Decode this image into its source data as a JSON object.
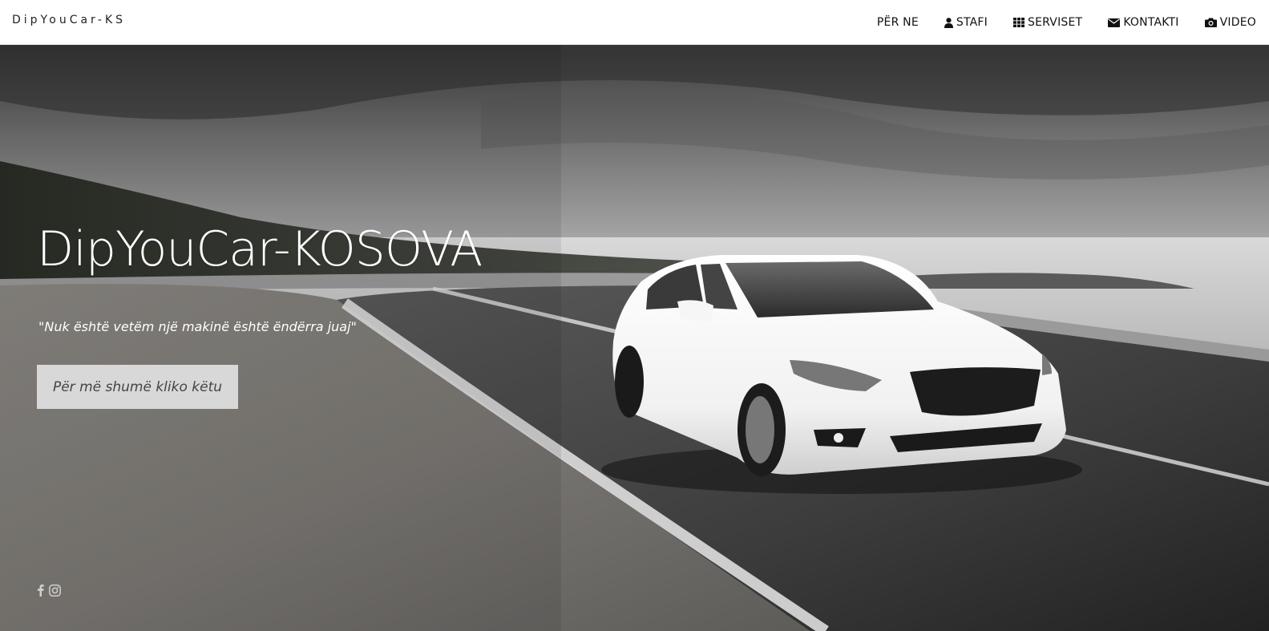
{
  "navbar": {
    "brand": "DipYouCar-KS",
    "items": [
      {
        "label": "PËR NE",
        "icon": ""
      },
      {
        "label": "STAFI",
        "icon": "user-icon"
      },
      {
        "label": "SERVISET",
        "icon": "grid-icon"
      },
      {
        "label": "KONTAKTI",
        "icon": "envelope-icon"
      },
      {
        "label": "VIDEO",
        "icon": "camera-icon"
      }
    ]
  },
  "hero": {
    "title": "DipYouCar-KOSOVA",
    "tagline": "\"Nuk është vetëm një makinë është ëndërra juaj\"",
    "cta_label": "Për më shumë kliko këtu",
    "background_image": "white sedan driving on coastal road, greyscale"
  },
  "social": {
    "icons": [
      "facebook-icon",
      "instagram-icon"
    ]
  }
}
